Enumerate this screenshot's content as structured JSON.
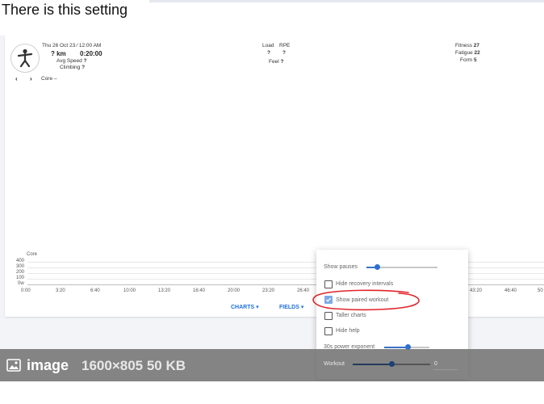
{
  "heading": "There is this setting",
  "activity": {
    "datetime": "Thu 26 Oct 23 ⁄ 12:00 AM",
    "distance": "? km",
    "duration": "0:20:00",
    "avg_speed_label": "Avg Speed",
    "avg_speed_value": "?",
    "climbing_label": "Climbing",
    "climbing_value": "?",
    "nav_prev": "‹",
    "nav_next": "›",
    "profile": "Core",
    "profile_value": "–"
  },
  "metrics": {
    "load_label": "Load",
    "load_value": "?",
    "rpe_label": "RPE",
    "rpe_value": "?",
    "feel_label": "Feel",
    "feel_value": "?"
  },
  "fitness": {
    "fitness_label": "Fitness",
    "fitness_value": "27",
    "fatigue_label": "Fatigue",
    "fatigue_value": "22",
    "form_label": "Form",
    "form_value": "5"
  },
  "chart": {
    "series_label": "Core",
    "y_ticks": [
      "400",
      "300",
      "200",
      "100",
      "0w"
    ],
    "x_ticks": [
      "0:00",
      "3:20",
      "6:40",
      "10:00",
      "13:20",
      "16:40",
      "20:00",
      "23:20",
      "26:40",
      "43:20",
      "46:40",
      "50"
    ]
  },
  "buttons": {
    "charts": "CHARTS ▾",
    "fields": "FIELDS ▾"
  },
  "menu": {
    "show_pauses": "Show pauses",
    "show_pauses_level": 0.15,
    "hide_recovery": "Hide recovery intervals",
    "show_paired": "Show paired workout",
    "taller_charts": "Taller charts",
    "hide_help": "Hide help",
    "power_exponent": "30s power exponent",
    "power_exponent_level": 0.52,
    "workout_label": "Workout",
    "workout_value": "0",
    "workout_level": 0.5
  },
  "caption": {
    "label": "image",
    "meta": "1600×805 50 KB"
  },
  "colors": {
    "accent": "#1e6fd9",
    "annotation": "#e0262a"
  }
}
